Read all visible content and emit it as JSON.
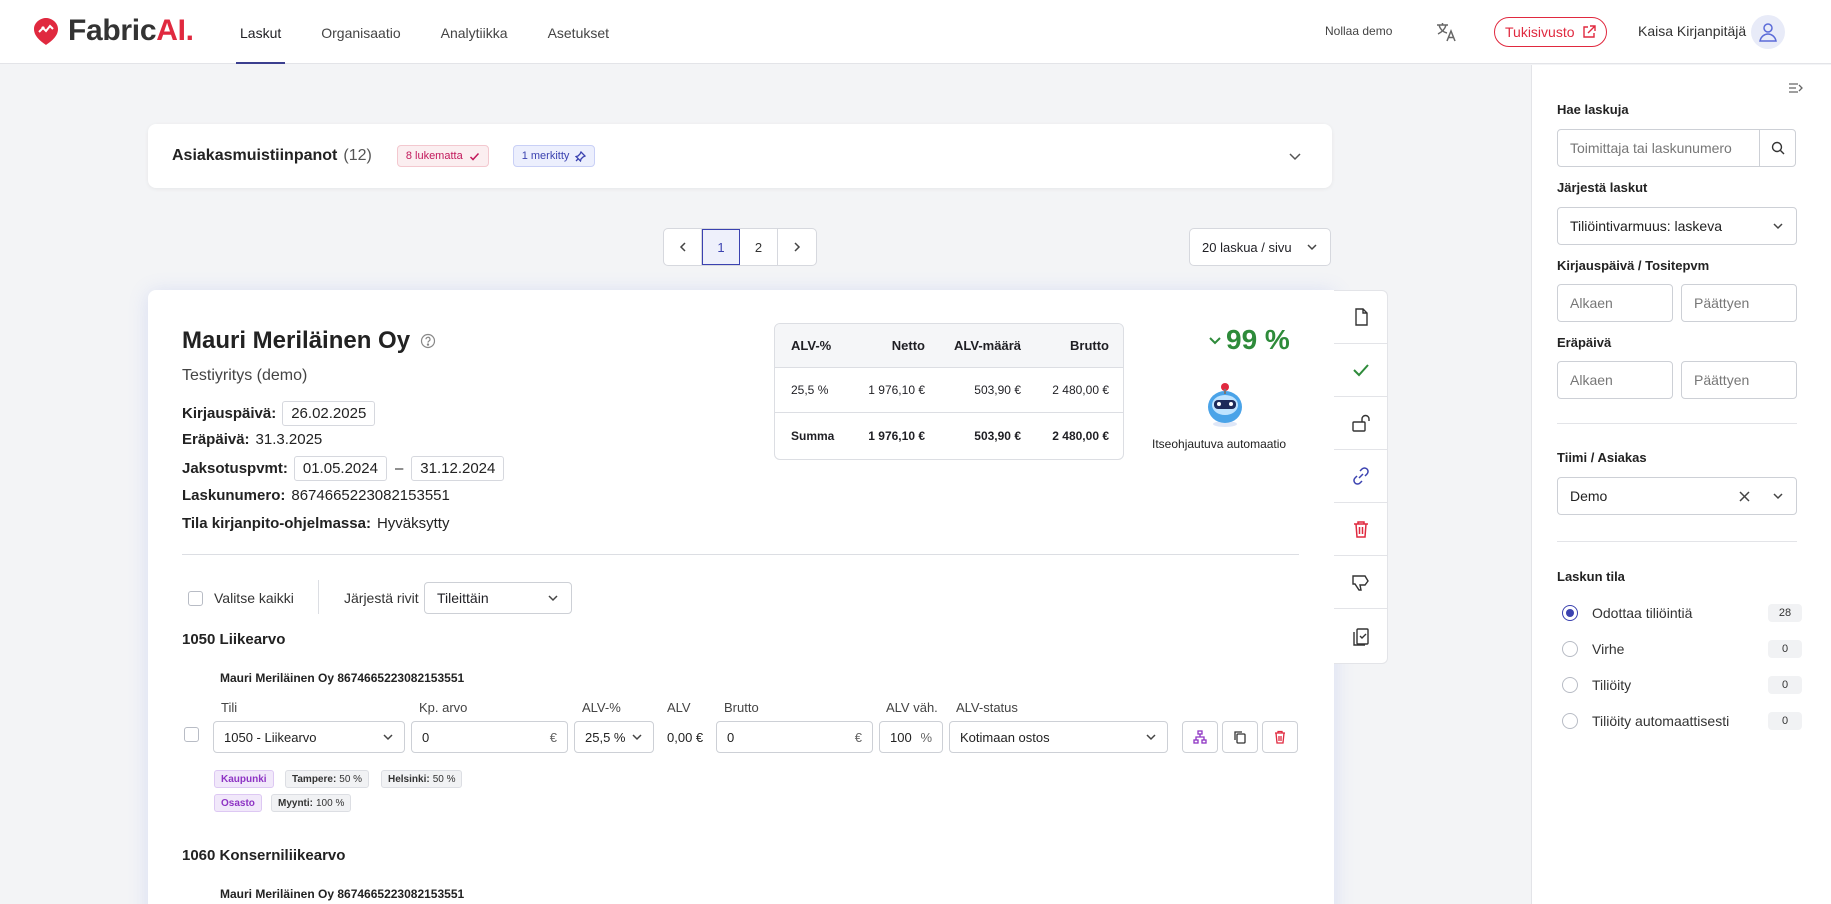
{
  "topbar": {
    "logo_a": "Fabric",
    "logo_b": "AI.",
    "nav": [
      "Laskut",
      "Organisaatio",
      "Analytiikka",
      "Asetukset"
    ],
    "reset_demo": "Nollaa demo",
    "support": "Tukisivusto",
    "user": "Kaisa Kirjanpitäjä",
    "icons": {
      "logo": "fabric-logo",
      "lang": "translate-icon",
      "external": "external-link-icon",
      "avatar": "user-icon"
    }
  },
  "notes": {
    "title": "Asiakasmuistiinpanot",
    "count": "(12)",
    "unread": "8 lukematta",
    "marked": "1 merkitty"
  },
  "pagination": {
    "pages": [
      "1",
      "2"
    ],
    "current": "1",
    "per_page": "20 laskua / sivu"
  },
  "invoice": {
    "company": "Mauri Meriläinen Oy",
    "subtitle": "Testiyritys (demo)",
    "booking_date_label": "Kirjauspäivä:",
    "booking_date": "26.02.2025",
    "due_date_label": "Eräpäivä:",
    "due_date": "31.3.2025",
    "period_label": "Jaksotuspvmt:",
    "period_start": "01.05.2024",
    "period_dash": "–",
    "period_end": "31.12.2024",
    "number_label": "Laskunumero:",
    "number": "8674665223082153551",
    "status_label": "Tila kirjanpito-ohjelmassa:",
    "status": "Hyväksytty",
    "vat_table": {
      "headers": [
        "ALV-%",
        "Netto",
        "ALV-määrä",
        "Brutto"
      ],
      "rows": [
        [
          "25,5 %",
          "1 976,10 €",
          "503,90 €",
          "2 480,00 €"
        ]
      ],
      "sum": [
        "Summa",
        "1 976,10 €",
        "503,90 €",
        "2 480,00 €"
      ]
    },
    "confidence": "99 %",
    "automation_label": "Itseohjautuva automaatio",
    "select_all": "Valitse kaikki",
    "sort_rows_label": "Järjestä rivit",
    "sort_rows_value": "Tileittäin",
    "accounts": [
      {
        "title": "1050 Liikearvo",
        "line_title": "Mauri Meriläinen Oy 8674665223082153551",
        "labels": {
          "account": "Tili",
          "cost": "Kp. arvo",
          "vat_pct": "ALV-%",
          "vat": "ALV",
          "gross": "Brutto",
          "vat_deduct": "ALV väh.",
          "vat_status": "ALV-status"
        },
        "account": "1050 - Liikearvo",
        "cost": "0",
        "currency": "€",
        "vat_pct": "25,5 %",
        "vat": "0,00 €",
        "gross": "0",
        "vat_deduct": "100",
        "pct": "%",
        "vat_status": "Kotimaan ostos",
        "dimensions": [
          {
            "name": "Kaupunki",
            "values": [
              {
                "k": "Tampere:",
                "v": "50 %"
              },
              {
                "k": "Helsinki:",
                "v": "50 %"
              }
            ]
          },
          {
            "name": "Osasto",
            "values": [
              {
                "k": "Myynti:",
                "v": "100 %"
              }
            ]
          }
        ]
      },
      {
        "title": "1060 Konserniliikearvo",
        "line_title": "Mauri Meriläinen Oy 8674665223082153551"
      }
    ]
  },
  "filters": {
    "search_label": "Hae laskuja",
    "search_placeholder": "Toimittaja tai laskunumero",
    "sort_label": "Järjestä laskut",
    "sort_value": "Tiliöintivarmuus: laskeva",
    "date_label": "Kirjauspäivä / Tositepvm",
    "from": "Alkaen",
    "to": "Päättyen",
    "due_label": "Eräpäivä",
    "team_label": "Tiimi / Asiakas",
    "team_value": "Demo",
    "status_label": "Laskun tila",
    "statuses": [
      {
        "label": "Odottaa tiliöintiä",
        "count": "28"
      },
      {
        "label": "Virhe",
        "count": "0"
      },
      {
        "label": "Tiliöity",
        "count": "0"
      },
      {
        "label": "Tiliöity automaattisesti",
        "count": "0"
      }
    ]
  },
  "colors": {
    "brand": "#e0293f",
    "accent": "#3b42b0",
    "success": "#2e8b3a",
    "danger": "#e0293f",
    "purple": "#8e34c4"
  }
}
